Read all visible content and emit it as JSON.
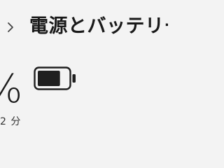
{
  "header": {
    "breadcrumb_current": "電源とバッテリー"
  },
  "battery": {
    "percent_label": "%",
    "level_fraction": 0.72,
    "time_remaining": "2 分"
  },
  "icons": {
    "breadcrumb_separator": "chevron-right-icon",
    "battery": "battery-icon"
  }
}
